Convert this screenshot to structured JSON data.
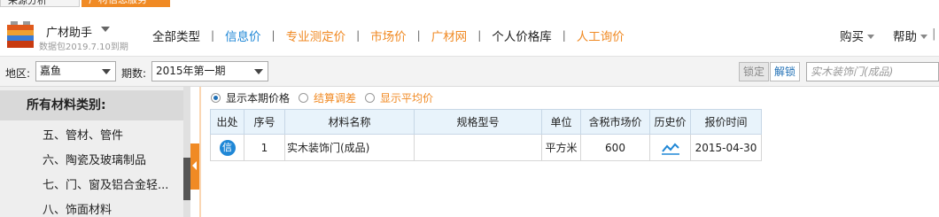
{
  "tabs": [
    "采源分析",
    "广材信息服务"
  ],
  "brand": {
    "name": "广材助手",
    "subtitle": "数据包2019.7.10到期"
  },
  "nav": {
    "items": [
      "全部类型",
      "信息价",
      "专业测定价",
      "市场价",
      "广材网",
      "个人价格库",
      "人工询价"
    ],
    "active": "信息价",
    "right": [
      "购买",
      "帮助"
    ]
  },
  "filter": {
    "region_label": "地区:",
    "region_value": "嘉鱼",
    "period_label": "期数:",
    "period_value": "2015年第一期",
    "lock_label": "锁定",
    "unlock_label": "解锁",
    "search_value": "实木装饰门(成品)"
  },
  "sidebar": {
    "title": "所有材料类别:",
    "items": [
      "五、管材、管件",
      "六、陶瓷及玻璃制品",
      "七、门、窗及铝合金轻...",
      "八、饰面材料"
    ]
  },
  "radios": [
    {
      "label": "显示本期价格",
      "checked": true
    },
    {
      "label": "结算调差",
      "checked": false
    },
    {
      "label": "显示平均价",
      "checked": false
    }
  ],
  "table": {
    "columns": [
      "出处",
      "序号",
      "材料名称",
      "规格型号",
      "单位",
      "含税市场价",
      "历史价",
      "报价时间"
    ],
    "rows": [
      {
        "source": "信",
        "index": "1",
        "name": "实木装饰门(成品)",
        "spec": "",
        "unit": "平方米",
        "price": "600",
        "history": "trend-icon",
        "date": "2015-04-30"
      }
    ]
  },
  "colors": {
    "accent": "#f08a24",
    "link_blue": "#1f87d6"
  }
}
